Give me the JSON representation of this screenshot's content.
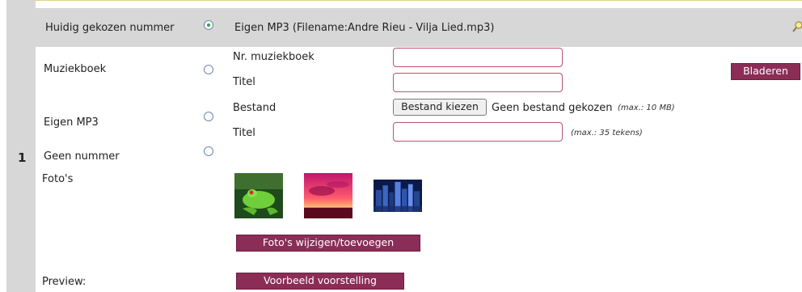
{
  "row_number": "1",
  "current": {
    "label": "Huidig gekozen nummer",
    "value": "Eigen MP3 (Filename:Andre Rieu - Vilja Lied.mp3)"
  },
  "muziekboek": {
    "label": "Muziekboek",
    "nr_label": "Nr. muziekboek",
    "titel_label": "Titel",
    "browse_button": "Bladeren"
  },
  "eigen_mp3": {
    "label": "Eigen MP3",
    "bestand_label": "Bestand",
    "file_button": "Bestand kiezen",
    "no_file_text": "Geen bestand gekozen",
    "file_hint": "(max.: 10 MB)",
    "titel_label": "Titel",
    "titel_hint": "(max.: 35 tekens)"
  },
  "geen_nummer": {
    "label": "Geen nummer"
  },
  "fotos": {
    "label": "Foto's",
    "thumbnails": [
      "frog-photo",
      "sunset-photo",
      "city-night-photo"
    ],
    "edit_button": "Foto's wijzigen/toevoegen"
  },
  "preview": {
    "label": "Preview:",
    "button": "Voorbeeld voorstelling"
  },
  "colors": {
    "header_bg": "#d7d7d7",
    "button_bg": "#8b2d57",
    "input_border": "#b9546f"
  }
}
